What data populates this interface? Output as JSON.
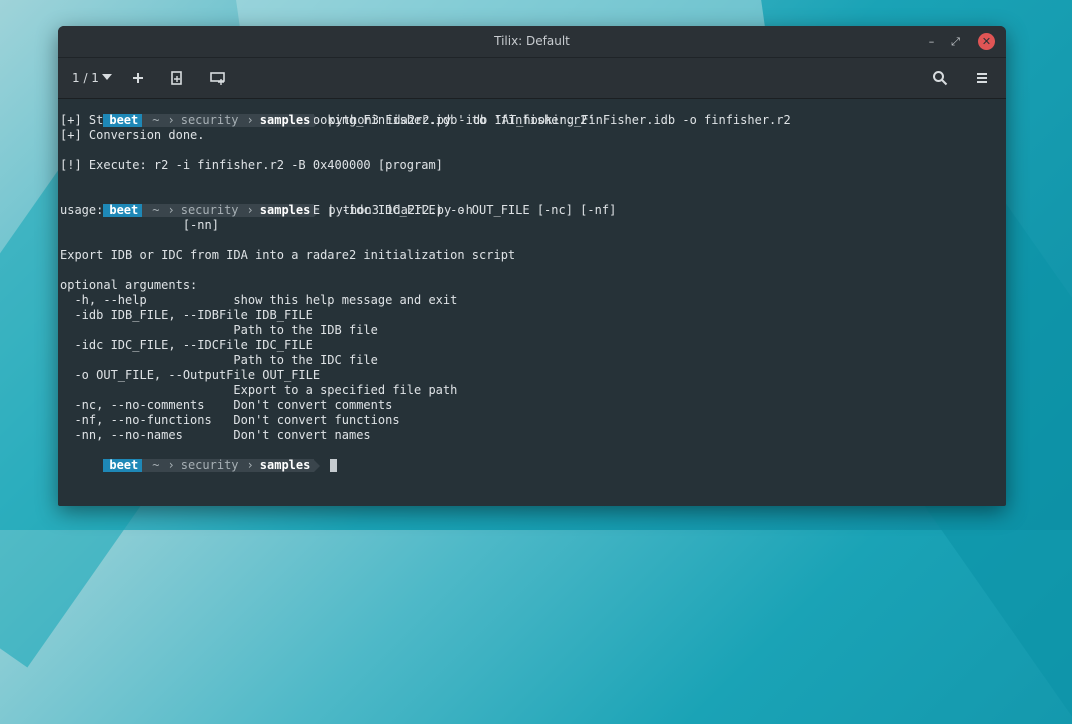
{
  "window": {
    "title": "Tilix: Default",
    "min_symbol": "–",
    "max_symbol": "⤢",
    "close_symbol": "✕"
  },
  "toolbar": {
    "session_count": "1 / 1",
    "icons": [
      "add-terminal-icon",
      "split-vertical-icon",
      "split-horizontal-icon",
      "search-icon",
      "menu-icon"
    ]
  },
  "colors": {
    "terminal_bg": "#263238",
    "prompt_user_bg": "#1e88b7",
    "prompt_path_bg": "#3a454c",
    "close_button": "#e05555"
  },
  "prompt": {
    "user": "beet",
    "home": "~",
    "dir1": "security",
    "dir2": "samples"
  },
  "terminal": {
    "cmd1": "python3 ida2r2.py -idb IAT_hooking_FinFisher.idb -o finfisher.r2",
    "out1": [
      "[+] Starting conversion from 'IAT_hooking_FinFisher.idb' to 'finfisher.r2'",
      "[+] Conversion done.",
      "",
      "[!] Execute: r2 -i finfisher.r2 -B 0x400000 [program]",
      ""
    ],
    "cmd2": "python3 ida2r2.py -h",
    "out2": [
      "usage: ida2r2.py [-h] (-idb IDB_FILE | -idc IDC_FILE) -o OUT_FILE [-nc] [-nf]",
      "                 [-nn]",
      "",
      "Export IDB or IDC from IDA into a radare2 initialization script",
      "",
      "optional arguments:",
      "  -h, --help            show this help message and exit",
      "  -idb IDB_FILE, --IDBFile IDB_FILE",
      "                        Path to the IDB file",
      "  -idc IDC_FILE, --IDCFile IDC_FILE",
      "                        Path to the IDC file",
      "  -o OUT_FILE, --OutputFile OUT_FILE",
      "                        Export to a specified file path",
      "  -nc, --no-comments    Don't convert comments",
      "  -nf, --no-functions   Don't convert functions",
      "  -nn, --no-names       Don't convert names"
    ]
  }
}
